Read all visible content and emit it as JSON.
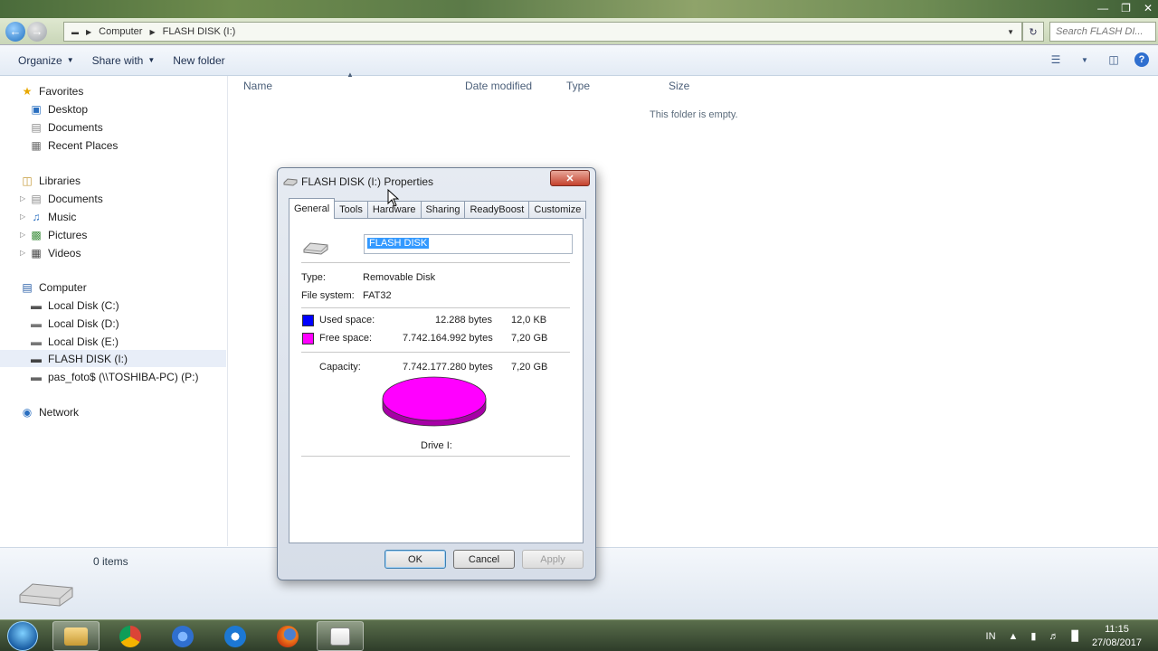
{
  "address": {
    "crumbs": [
      "Computer",
      "FLASH DISK (I:)"
    ],
    "search_placeholder": "Search FLASH DI..."
  },
  "toolbar": {
    "organize_label": "Organize",
    "share_label": "Share with",
    "new_folder_label": "New folder"
  },
  "navpane": {
    "favorites": "Favorites",
    "desktop": "Desktop",
    "documents": "Documents",
    "recent": "Recent Places",
    "libraries": "Libraries",
    "lib_documents": "Documents",
    "music": "Music",
    "pictures": "Pictures",
    "videos": "Videos",
    "computer": "Computer",
    "disk_c": "Local Disk (C:)",
    "disk_d": "Local Disk (D:)",
    "disk_e": "Local Disk (E:)",
    "disk_i": "FLASH DISK (I:)",
    "net_drive": "pas_foto$ (\\\\TOSHIBA-PC) (P:)",
    "network": "Network"
  },
  "content": {
    "columns": [
      "Name",
      "Date modified",
      "Type",
      "Size"
    ],
    "empty_message": "This folder is empty."
  },
  "status": {
    "items": "0 items"
  },
  "dialog": {
    "title": "FLASH DISK (I:) Properties",
    "tabs": [
      "General",
      "Tools",
      "Hardware",
      "Sharing",
      "ReadyBoost",
      "Customize"
    ],
    "volume_name": "FLASH DISK",
    "type_label": "Type:",
    "type_value": "Removable Disk",
    "fs_label": "File system:",
    "fs_value": "FAT32",
    "used_label": "Used space:",
    "used_bytes": "12.288 bytes",
    "used_size": "12,0 KB",
    "free_label": "Free space:",
    "free_bytes": "7.742.164.992 bytes",
    "free_size": "7,20 GB",
    "capacity_label": "Capacity:",
    "capacity_bytes": "7.742.177.280 bytes",
    "capacity_size": "7,20 GB",
    "drive_label": "Drive I:",
    "ok": "OK",
    "cancel": "Cancel",
    "apply": "Apply",
    "used_color": "#0000ff",
    "free_color": "#ff00ff"
  },
  "taskbar": {
    "language": "IN",
    "time": "11:15",
    "date": "27/08/2017"
  }
}
